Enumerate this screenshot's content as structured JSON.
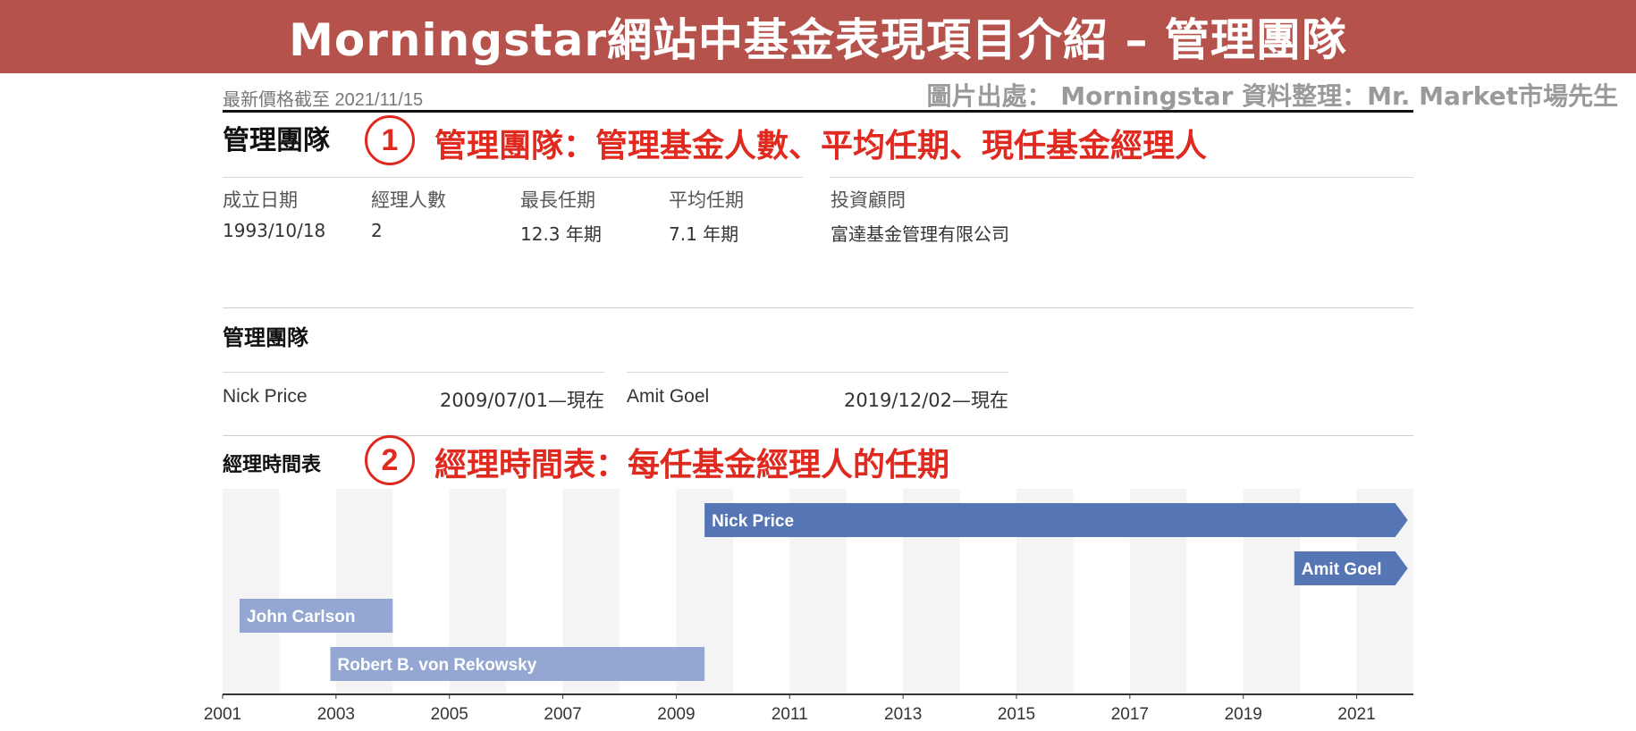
{
  "banner": {
    "title": "Morningstar網站中基金表現項目介紹 – 管理團隊"
  },
  "header": {
    "price_date": "最新價格截至 2021/11/15",
    "source": "圖片出處： Morningstar  資料整理：Mr. Market市場先生"
  },
  "team_section": {
    "title": "管理團隊",
    "annotation_number": "1",
    "annotation_text": "管理團隊：管理基金人數、平均任期、現任基金經理人"
  },
  "stats": [
    {
      "label": "成立日期",
      "value": "1993/10/18"
    },
    {
      "label": "經理人數",
      "value": "2"
    },
    {
      "label": "最長任期",
      "value": "12.3 年期"
    },
    {
      "label": "平均任期",
      "value": "7.1 年期"
    },
    {
      "label": "投資顧問",
      "value": "富達基金管理有限公司"
    }
  ],
  "managers_section": {
    "title": "管理團隊",
    "managers": [
      {
        "name": "Nick Price",
        "period": "2009/07/01—現在"
      },
      {
        "name": "Amit Goel",
        "period": "2019/12/02—現在"
      }
    ]
  },
  "timeline_section": {
    "title": "經理時間表",
    "annotation_number": "2",
    "annotation_text": "經理時間表：每任基金經理人的任期"
  },
  "colors": {
    "banner": "#b5524c",
    "annotation": "#e0291f",
    "current_manager_bar": "#5575b5",
    "former_manager_bar": "#93a7d2"
  },
  "chart_data": {
    "type": "bar",
    "orientation": "horizontal-timeline",
    "xlim": [
      2001,
      2022
    ],
    "x_ticks": [
      "2001",
      "2003",
      "2005",
      "2007",
      "2009",
      "2011",
      "2013",
      "2015",
      "2017",
      "2019",
      "2021"
    ],
    "series": [
      {
        "name": "Nick Price",
        "start": 2009.5,
        "end": "現在",
        "current": true
      },
      {
        "name": "Amit Goel",
        "start": 2019.9,
        "end": "現在",
        "current": true
      },
      {
        "name": "John Carlson",
        "start": 2001.3,
        "end": 2004.0,
        "current": false
      },
      {
        "name": "Robert B. von Rekowsky",
        "start": 2002.9,
        "end": 2009.5,
        "current": false
      }
    ]
  }
}
